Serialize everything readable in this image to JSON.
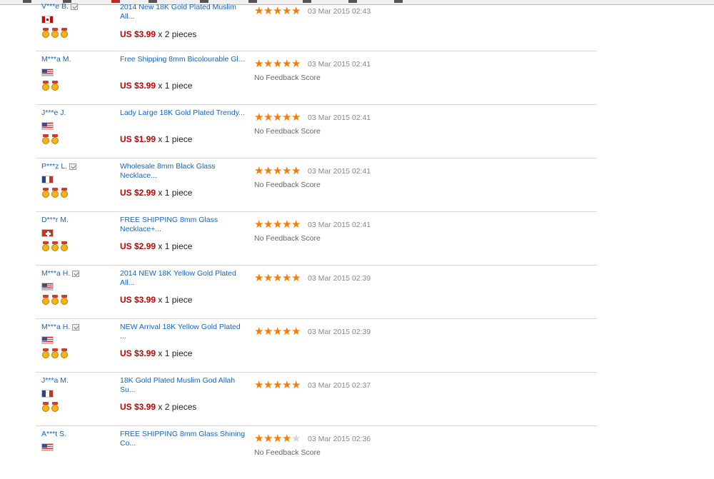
{
  "colors": {
    "link": "#1565c0",
    "price": "#c40000",
    "star": "#ff7a00",
    "divider": "#d9d9d9"
  },
  "transactions": [
    {
      "buyer": "V***e B.",
      "verified": true,
      "flag": "ca",
      "medals": 3,
      "product": "2014 New 18K Gold Plated Muslim All...",
      "price": "US $3.99",
      "qty": "x 2 pieces",
      "stars": 5,
      "date": "03 Mar 2015 02:43",
      "feedback_score": ""
    },
    {
      "buyer": "M***a M.",
      "verified": false,
      "flag": "us",
      "medals": 2,
      "product": "Free Shipping 8mm Bicolourable Gl...",
      "price": "US $3.99",
      "qty": "x 1 piece",
      "stars": 5,
      "date": "03 Mar 2015 02:41",
      "feedback_score": "No Feedback Score"
    },
    {
      "buyer": "J***e J.",
      "verified": false,
      "flag": "us",
      "medals": 2,
      "product": "Lady Large 18K Gold Plated Trendy...",
      "price": "US $1.99",
      "qty": "x 1 piece",
      "stars": 5,
      "date": "03 Mar 2015 02:41",
      "feedback_score": "No Feedback Score"
    },
    {
      "buyer": "P***z L.",
      "verified": true,
      "flag": "fr",
      "medals": 3,
      "product": "Wholesale 8mm Black Glass Necklace...",
      "price": "US $2.99",
      "qty": "x 1 piece",
      "stars": 5,
      "date": "03 Mar 2015 02:41",
      "feedback_score": "No Feedback Score"
    },
    {
      "buyer": "D***r M.",
      "verified": false,
      "flag": "ch",
      "medals": 3,
      "product": "FREE SHIPPING 8mm Glass Necklace+...",
      "price": "US $2.99",
      "qty": "x 1 piece",
      "stars": 5,
      "date": "03 Mar 2015 02:41",
      "feedback_score": "No Feedback Score"
    },
    {
      "buyer": "M***a H.",
      "verified": true,
      "flag": "us",
      "medals": 3,
      "product": "2014 NEW 18K Yellow Gold Plated All...",
      "price": "US $3.99",
      "qty": "x 1 piece",
      "stars": 5,
      "date": "03 Mar 2015 02:39",
      "feedback_score": ""
    },
    {
      "buyer": "M***a H.",
      "verified": true,
      "flag": "us",
      "medals": 3,
      "product": "NEW Arrival 18K Yellow Gold Plated ...",
      "price": "US $3.99",
      "qty": "x 1 piece",
      "stars": 5,
      "date": "03 Mar 2015 02:39",
      "feedback_score": ""
    },
    {
      "buyer": "J***a M.",
      "verified": false,
      "flag": "fr",
      "medals": 2,
      "product": "18K Gold Plated Muslim God Allah Su...",
      "price": "US $3.99",
      "qty": "x 2 pieces",
      "stars": 5,
      "date": "03 Mar 2015 02:37",
      "feedback_score": ""
    },
    {
      "buyer": "A***t S.",
      "verified": false,
      "flag": "us",
      "medals": 0,
      "product": "FREE SHIPPING 8mm Glass Shining Co...",
      "price": "",
      "qty": "",
      "stars": 4,
      "date": "03 Mar 2015 02:36",
      "feedback_score": "No Feedback Score"
    }
  ]
}
